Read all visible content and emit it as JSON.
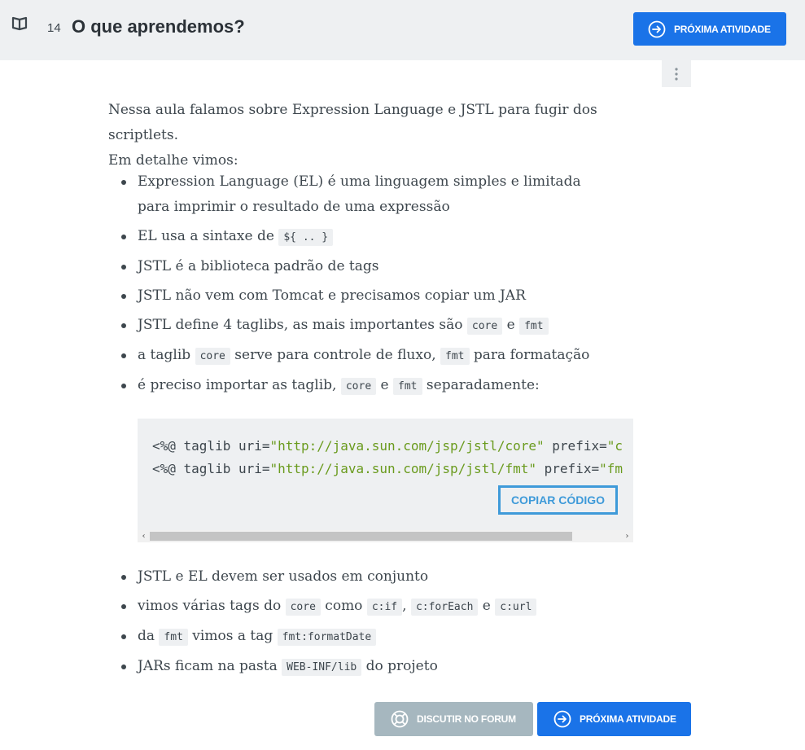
{
  "header": {
    "lesson_number": "14",
    "title": "O que aprendemos?",
    "next_button": "PRÓXIMA ATIVIDADE"
  },
  "content": {
    "intro_line1": "Nessa aula falamos sobre Expression Language e JSTL para fugir dos scriptlets.",
    "intro_line2": "Em detalhe vimos:",
    "items": {
      "i1": "Expression Language (EL) é uma linguagem simples e limitada para imprimir o resultado de uma expressão",
      "i2_text": "EL usa a sintaxe de ",
      "i2_code": "${ .. }",
      "i3": "JSTL é a biblioteca padrão de tags",
      "i4": "JSTL não vem com Tomcat e precisamos copiar um JAR",
      "i5_text": "JSTL define 4 taglibs, as mais importantes são ",
      "i5_code1": "core",
      "i5_and": " e ",
      "i5_code2": "fmt",
      "i6_text1": "a taglib ",
      "i6_code1": "core",
      "i6_text2": " serve para controle de fluxo, ",
      "i6_code2": "fmt",
      "i6_text3": " para formatação",
      "i7_text1": "é preciso importar as taglib, ",
      "i7_code1": "core",
      "i7_and": " e ",
      "i7_code2": "fmt",
      "i7_text2": " separadamente:",
      "i8": "JSTL e EL devem ser usados em conjunto",
      "i9_text1": "vimos várias tags do ",
      "i9_code1": "core",
      "i9_text2": " como ",
      "i9_code2": "c:if",
      "i9_comma": ", ",
      "i9_code3": "c:forEach",
      "i9_and": " e ",
      "i9_code4": "c:url",
      "i10_text1": "da ",
      "i10_code1": "fmt",
      "i10_text2": " vimos a tag ",
      "i10_code2": "fmt:formatDate",
      "i11_text1": "JARs ficam na pasta ",
      "i11_code1": "WEB-INF/lib",
      "i11_text2": " do projeto"
    }
  },
  "code_block": {
    "line1_a": "<%@ taglib uri=",
    "line1_str": "\"http://java.sun.com/jsp/jstl/core\"",
    "line1_b": " prefix=",
    "line1_c": "\"c",
    "line2_a": "<%@ taglib uri=",
    "line2_str": "\"http://java.sun.com/jsp/jstl/fmt\"",
    "line2_b": " prefix=",
    "line2_c": "\"fm",
    "copy_button": "COPIAR CÓDIGO"
  },
  "footer": {
    "forum_button": "DISCUTIR NO FORUM",
    "next_button": "PRÓXIMA ATIVIDADE"
  },
  "colors": {
    "accent": "#1a73e8",
    "header_bg": "#eef0f2",
    "forum_btn": "#a6b7bf",
    "copy_btn": "#3e9ad9",
    "code_string": "#6a9b1e"
  },
  "icons": [
    "book-icon",
    "circle-arrow-right-icon",
    "kebab-menu-icon",
    "lifebuoy-icon"
  ]
}
